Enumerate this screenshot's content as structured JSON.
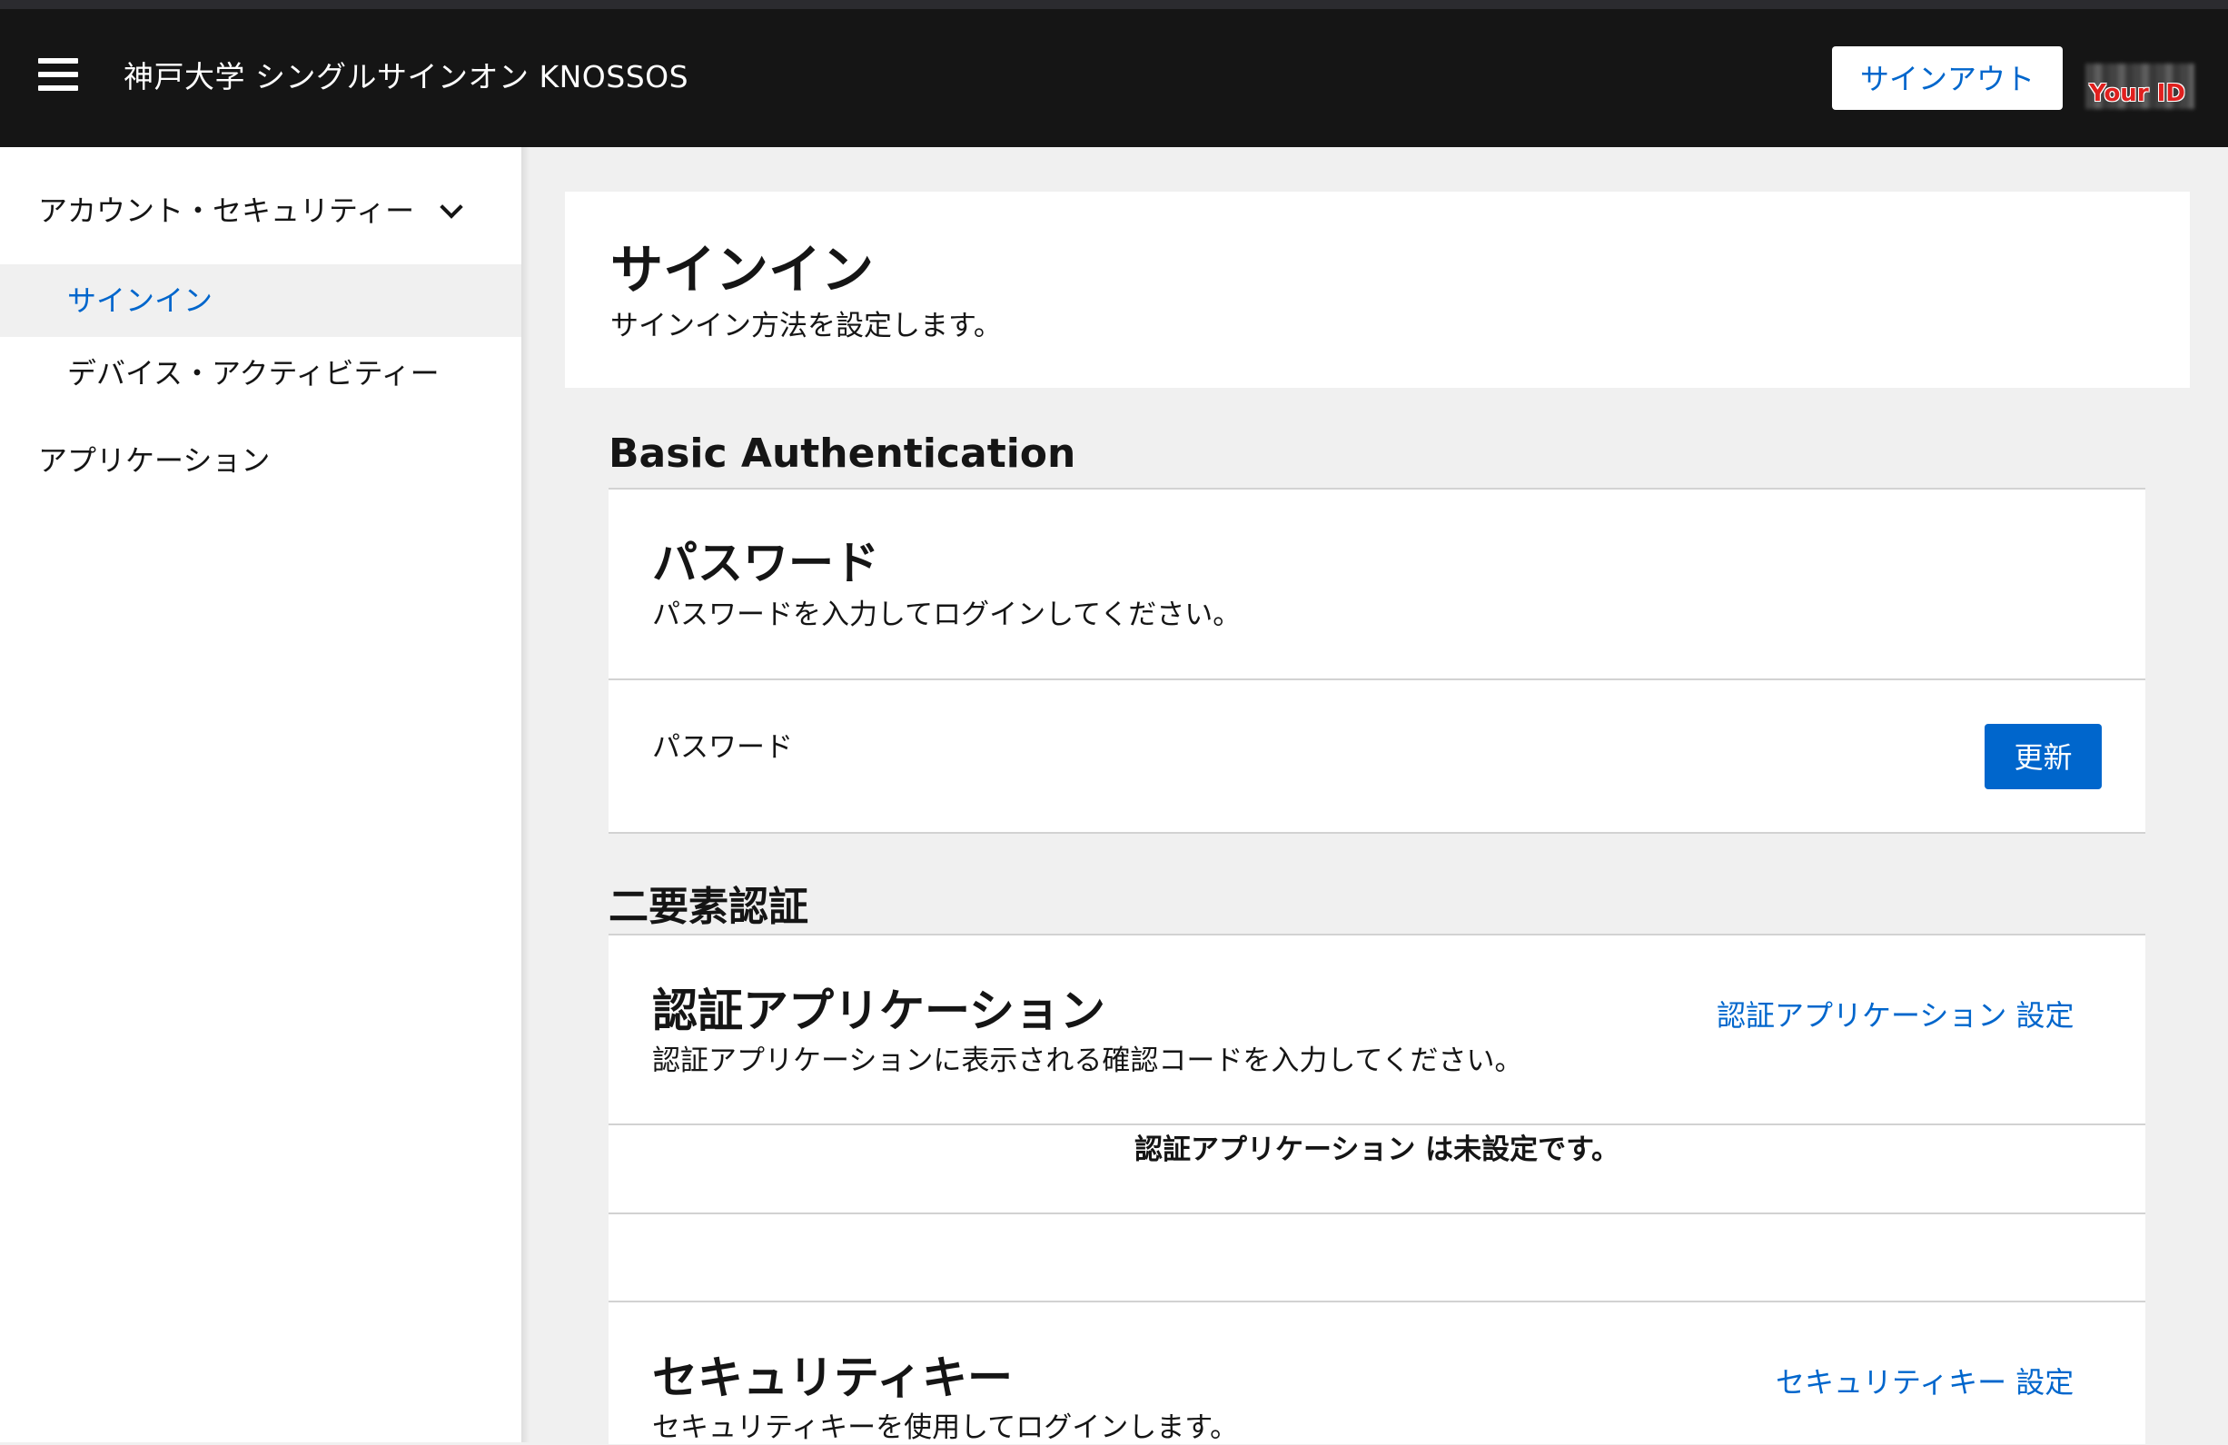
{
  "header": {
    "brand": "神戸大学 シングルサインオン KNOSSOS",
    "signout_label": "サインアウト",
    "user_label": "Your ID"
  },
  "icons": {
    "menu": "hamburger-icon",
    "expand": "chevron-down-icon"
  },
  "sidebar": {
    "group_label": "アカウント・セキュリティー",
    "items": [
      {
        "label": "サインイン",
        "active": true
      },
      {
        "label": "デバイス・アクティビティー",
        "active": false
      }
    ],
    "applications_label": "アプリケーション"
  },
  "page": {
    "title": "サインイン",
    "description": "サインイン方法を設定します。"
  },
  "basic_auth": {
    "section_title": "Basic Authentication",
    "card_title": "パスワード",
    "card_desc": "パスワードを入力してログインしてください。",
    "row_label": "パスワード",
    "update_label": "更新"
  },
  "two_factor": {
    "section_title": "二要素認証",
    "otp": {
      "title": "認証アプリケーション",
      "desc": "認証アプリケーションに表示される確認コードを入力してください。",
      "setup_link": "認証アプリケーション 設定",
      "empty_msg": "認証アプリケーション は未設定です。"
    },
    "security_key": {
      "title": "セキュリティキー",
      "desc": "セキュリティキーを使用してログインします。",
      "setup_link": "セキュリティキー 設定"
    }
  },
  "colors": {
    "header_bg": "#151515",
    "accent": "#0066cc",
    "page_bg": "#f0f0f0"
  }
}
